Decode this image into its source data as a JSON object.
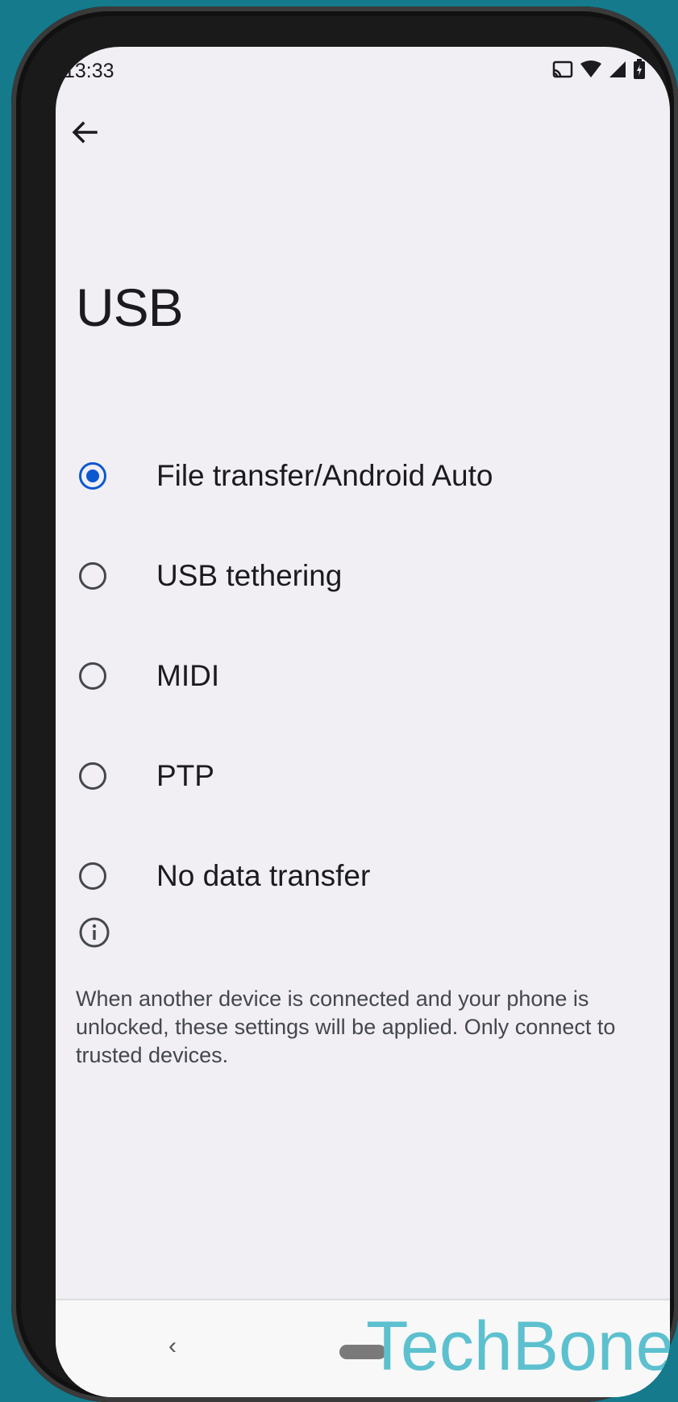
{
  "status_bar": {
    "time": "13:33",
    "icons": [
      "cast-icon",
      "wifi-icon",
      "signal-icon",
      "battery-charging-icon"
    ]
  },
  "header": {
    "title": "USB"
  },
  "usb_options": [
    {
      "label": "File transfer/Android Auto",
      "selected": true
    },
    {
      "label": "USB tethering",
      "selected": false
    },
    {
      "label": "MIDI",
      "selected": false
    },
    {
      "label": "PTP",
      "selected": false
    },
    {
      "label": "No data transfer",
      "selected": false
    }
  ],
  "info": {
    "text": "When another device is connected and your phone is unlocked, these settings will be applied. Only connect to trusted devices."
  },
  "nav_bar": {
    "back_glyph": "‹"
  },
  "watermark": {
    "text": "TechBone"
  },
  "colors": {
    "accent": "#0b57d0",
    "background": "#f1eff4",
    "frame_background": "#147a8c",
    "watermark": "#5cc0cf"
  }
}
